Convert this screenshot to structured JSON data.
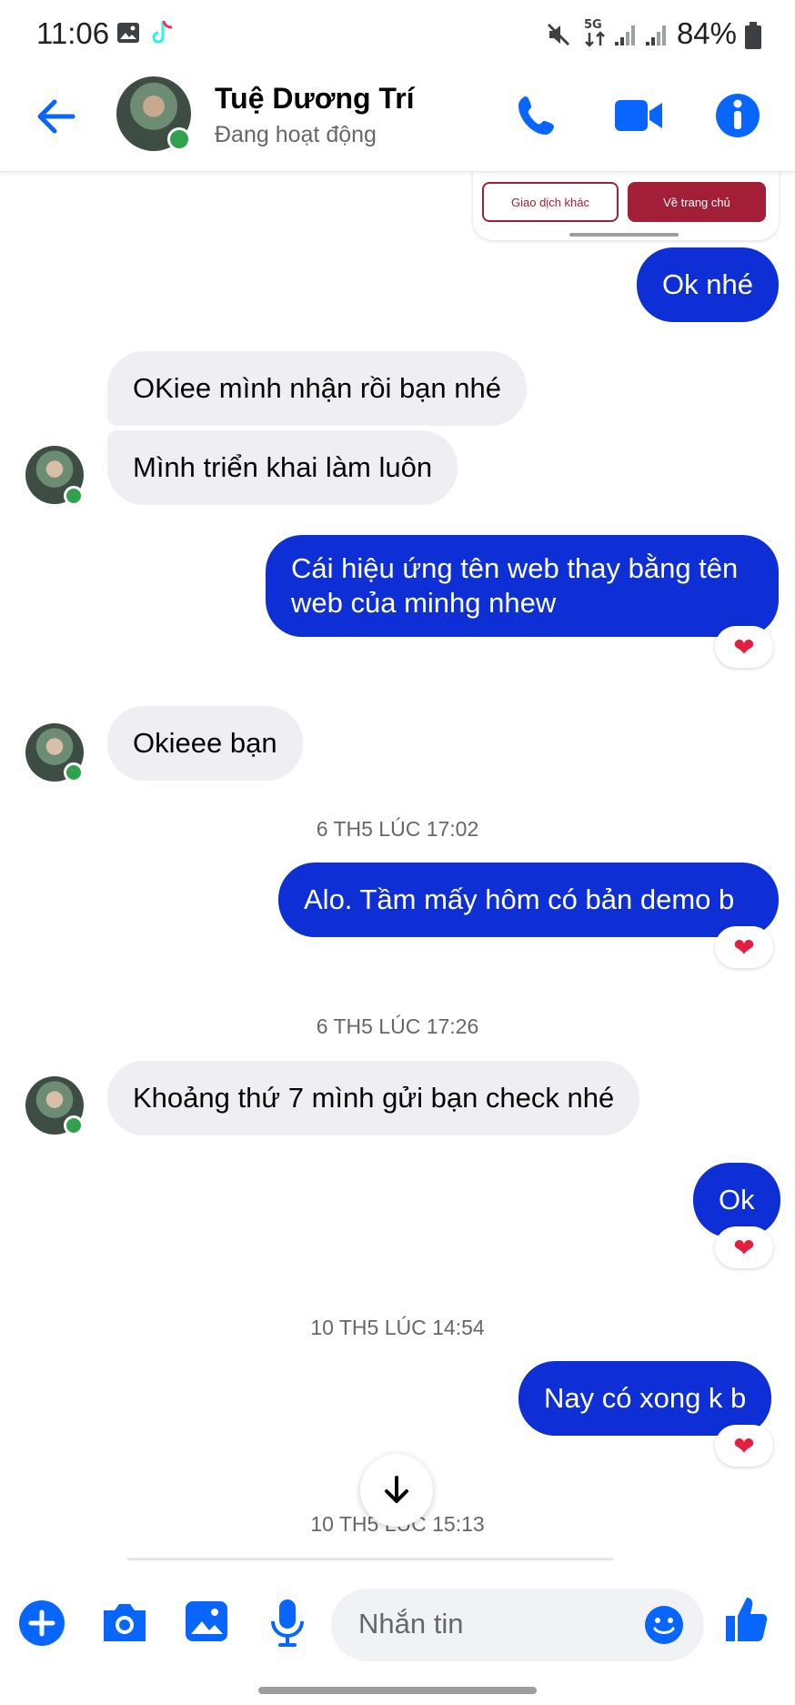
{
  "status_bar": {
    "time": "11:06",
    "battery": "84%"
  },
  "header": {
    "name": "Tuệ Dương Trí",
    "status": "Đang hoạt động"
  },
  "shared_card": {
    "button_other": "Giao dịch khác",
    "button_home": "Về trang chủ"
  },
  "messages": {
    "m1": "Ok nhé",
    "m2": "OKiee mình nhận rồi bạn nhé",
    "m3": "Mình triển khai làm luôn",
    "m4_line1": "Cái hiệu ứng tên web thay bằng tên",
    "m4_line2": "web của minhg nhew",
    "m5": "Okieee bạn",
    "m6": "Alo. Tầm mấy hôm có bản demo b",
    "m7": "Khoảng thứ 7 mình gửi bạn check nhé",
    "m8": "Ok",
    "m9": "Nay có xong k b"
  },
  "timestamps": {
    "t1": "6 TH5 LÚC 17:02",
    "t2": "6 TH5 LÚC 17:26",
    "t3": "10 TH5 LÚC 14:54",
    "t4": "10 TH5 LÚC 15:13"
  },
  "composer": {
    "placeholder": "Nhắn tin"
  },
  "colors": {
    "accent": "#0866ff",
    "outgoing_bubble": "#0f2fd6",
    "incoming_bubble": "#efeff3",
    "heart": "#e41e3f",
    "online": "#31a24c"
  },
  "icons": [
    "back-arrow-icon",
    "phone-icon",
    "video-icon",
    "info-icon",
    "plus-icon",
    "camera-icon",
    "gallery-icon",
    "mic-icon",
    "emoji-icon",
    "like-icon",
    "scroll-down-icon",
    "heart-icon"
  ]
}
